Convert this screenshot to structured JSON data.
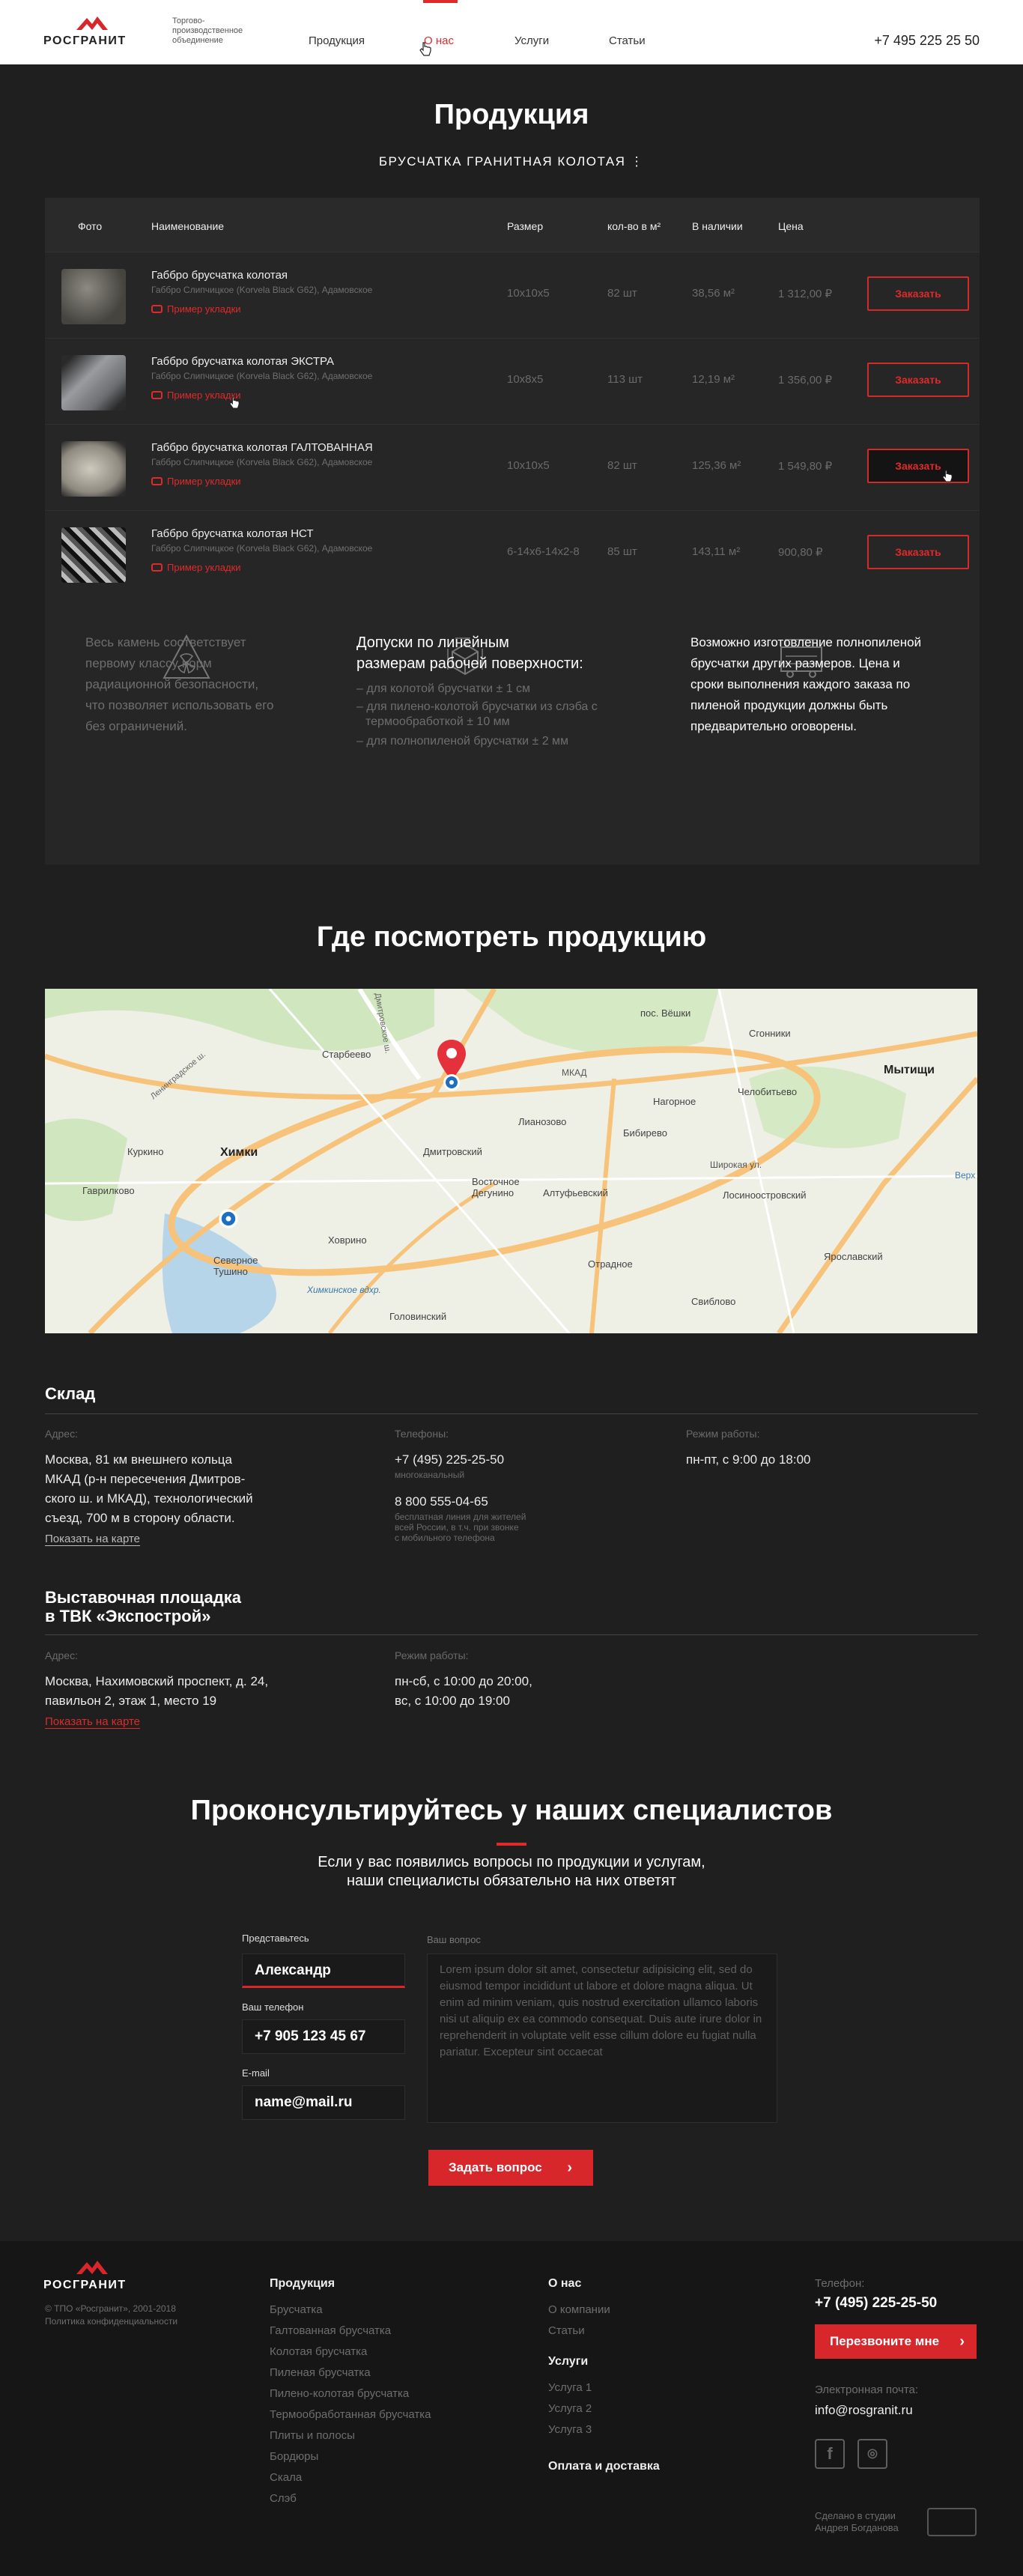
{
  "header": {
    "logo_text": "РОСГРАНИТ",
    "tagline": "Торгово-производственное объединение",
    "nav": [
      "Продукция",
      "О нас",
      "Услуги",
      "Статьи"
    ],
    "phone": "+7 495 225 25 50"
  },
  "products": {
    "title": "Продукция",
    "category": "БРУСЧАТКА ГРАНИТНАЯ КОЛОТАЯ",
    "columns": [
      "Фото",
      "Наименование",
      "Размер",
      "кол-во в м²",
      "В наличии",
      "Цена"
    ],
    "rows": [
      {
        "name": "Габбро брусчатка колотая",
        "material": "Габбро Слипчицкое (Korvela Black G62), Адамовское",
        "photo_link": "Пример укладки",
        "size": "10х10х5",
        "qty": "82 шт",
        "stock": "38,56 м²",
        "price": "1 312,00 ₽",
        "button": "Заказать"
      },
      {
        "name": "Габбро брусчатка колотая ЭКСТРА",
        "material": "Габбро Слипчицкое (Korvela Black G62), Адамовское",
        "photo_link": "Пример укладки",
        "size": "10х8х5",
        "qty": "113 шт",
        "stock": "12,19 м²",
        "price": "1 356,00 ₽",
        "button": "Заказать"
      },
      {
        "name": "Габбро брусчатка колотая ГАЛТОВАННАЯ",
        "material": "Габбро Слипчицкое (Korvela Black G62), Адамовское",
        "photo_link": "Пример укладки",
        "size": "10х10х5",
        "qty": "82 шт",
        "stock": "125,36 м²",
        "price": "1 549,80 ₽",
        "button": "Заказать"
      },
      {
        "name": "Габбро брусчатка колотая НСТ",
        "material": "Габбро Слипчицкое (Korvela Black G62), Адамовское",
        "photo_link": "Пример укладки",
        "size": "6-14х6-14х2-8",
        "qty": "85 шт",
        "stock": "143,11 м²",
        "price": "900,80 ₽",
        "button": "Заказать"
      }
    ],
    "info": {
      "radiation": [
        "Весь камень соответствует",
        "первому классу норм",
        "радиационной безопасности,",
        "что позволяет использовать его",
        "без ограничений."
      ],
      "tolerance_title": [
        "Допуски по линейным",
        "размерам рабочей поверхности:"
      ],
      "tolerance_items": [
        "– для колотой брусчатки ± 1 см",
        "– для пилено-колотой брусчатки из слэба с",
        "термообработкой ± 10 мм",
        "– для полнопиленой брусчатки ± 2 мм"
      ],
      "custom": [
        "Возможно изготовление полнопиленой",
        "брусчатки других размеров. Цена и",
        "сроки выполнения каждого заказа по",
        "пиленой продукции должны быть",
        "предварительно оговорены."
      ]
    }
  },
  "where": {
    "title": "Где посмотреть продукцию",
    "map_labels": [
      "Старбеево",
      "пос. Вёшки",
      "Сгонники",
      "Мытищи",
      "Химки",
      "Куркино",
      "Гаврилково",
      "Лианозово",
      "Дмитровский",
      "Восточное Дегунино",
      "Алтуфьевский",
      "Бибирево",
      "Лосиноостровский",
      "Ярославский",
      "Северное Тушино",
      "Ховрино",
      "Головинский",
      "Отрадное",
      "Свиблово",
      "Челобитьево",
      "Нагорное",
      "Широкая ул.",
      "Химкинское вдхр.",
      "Ленинградское ш.",
      "Дмитровское ш.",
      "МКАД",
      "Верх"
    ]
  },
  "warehouse": {
    "title": "Склад",
    "addr_label": "Адрес:",
    "addr": [
      "Москва, 81 км внешнего кольца",
      "МКАД (р-н пересечения Дмитров-",
      "ского ш. и МКАД), технологический",
      "съезд, 700 м в сторону области."
    ],
    "map_link": "Показать на карте",
    "phones_label": "Телефоны:",
    "phone1": "+7 (495) 225-25-50",
    "phone1_note": "многоканальный",
    "phone2": "8 800 555-04-65",
    "phone2_note": [
      "бесплатная линия для жителей",
      "всей России, в т.ч. при звонке",
      "с мобильного телефона"
    ],
    "hours_label": "Режим работы:",
    "hours": "пн-пт, с 9:00 до 18:00"
  },
  "expo": {
    "title": [
      "Выставочная площадка",
      "в ТВК «Экспострой»"
    ],
    "addr_label": "Адрес:",
    "addr": [
      "Москва, Нахимовский проспект, д. 24,",
      "павильон 2, этаж 1, место 19"
    ],
    "map_link": "Показать на карте",
    "hours_label": "Режим работы:",
    "hours": [
      "пн-сб, с 10:00 до 20:00,",
      "вс, с 10:00 до 19:00"
    ]
  },
  "consult": {
    "title": "Проконсультируйтесь у наших специалистов",
    "subtitle": [
      "Если у вас появились вопросы по продукции и услугам,",
      "наши специалисты обязательно на них ответят"
    ],
    "name_label": "Представьтесь",
    "name_value": "Александр",
    "phone_label": "Ваш телефон",
    "phone_value": "+7 905 123 45 67",
    "email_label": "E-mail",
    "email_value": "name@mail.ru",
    "question_label": "Ваш вопрос",
    "question_text": "Lorem ipsum dolor sit amet, consectetur adipisicing elit, sed do eiusmod tempor incididunt ut labore et dolore magna aliqua. Ut enim ad minim veniam, quis nostrud exercitation ullamco laboris nisi ut aliquip ex ea commodo consequat. Duis aute irure dolor in reprehenderit in voluptate velit esse cillum dolore eu fugiat nulla pariatur. Excepteur sint occaecat",
    "submit": "Задать вопрос"
  },
  "footer": {
    "logo_text": "РОСГРАНИТ",
    "copyright": "© ТПО «Росгранит», 2001-2018",
    "privacy": "Политика конфиденциальности",
    "products_title": "Продукция",
    "products": [
      "Брусчатка",
      "Галтованная брусчатка",
      "Колотая брусчатка",
      "Пиленая брусчатка",
      "Пилено-колотая брусчатка",
      "Термообработанная брусчатка",
      "Плиты и полосы",
      "Бордюры",
      "Скала",
      "Слэб"
    ],
    "about_title": "О нас",
    "about": [
      "О компании",
      "Статьи"
    ],
    "services_title": "Услуги",
    "services": [
      "Услуга 1",
      "Услуга 2",
      "Услуга 3"
    ],
    "delivery": "Оплата и доставка",
    "phone_label": "Телефон:",
    "phone": "+7 (495) 225-25-50",
    "call_button": "Перезвоните мне",
    "email_label": "Электронная почта:",
    "email": "info@rosgranit.ru",
    "made_by": [
      "Сделано в студии",
      "Андрея Богданова"
    ]
  },
  "colors": {
    "accent": "#d8272b",
    "bg": "#1f1f1f",
    "panel": "#262626"
  }
}
